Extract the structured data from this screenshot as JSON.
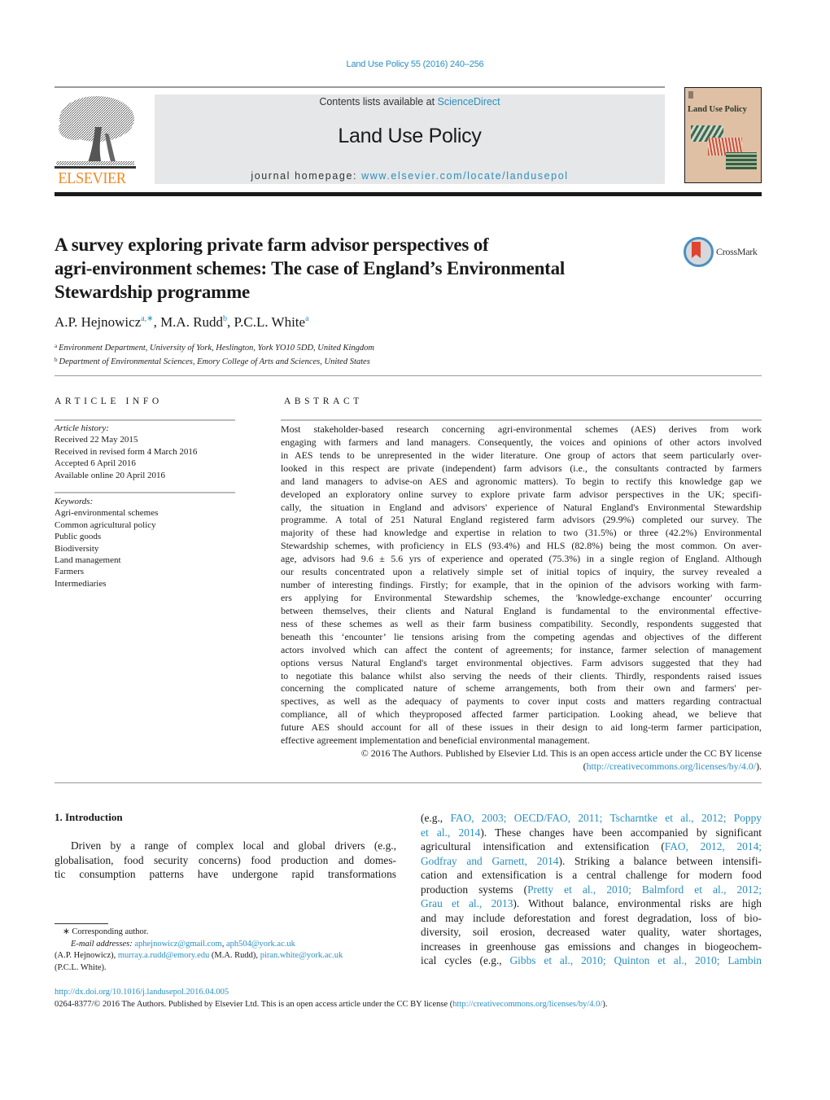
{
  "journal_ref": "Land Use Policy 55 (2016) 240–256",
  "header": {
    "publisher_logo_text": "ELSEVIER",
    "contents_prefix": "Contents lists available at ",
    "contents_link": "ScienceDirect",
    "journal_title": "Land Use Policy",
    "homepage_prefix": "journal homepage: ",
    "homepage_link": "www.elsevier.com/locate/landusepol",
    "cover_title": "Land Use Policy"
  },
  "article": {
    "title_lines": [
      "A survey exploring private farm advisor perspectives of",
      "agri-environment schemes: The case of England’s Environmental",
      "Stewardship programme"
    ],
    "crossmark_label": "CrossMark",
    "authors": [
      {
        "name": "A.P. Hejnowicz",
        "sup": "a,∗",
        "sep": ", "
      },
      {
        "name": "M.A. Rudd",
        "sup": "b",
        "sep": ", "
      },
      {
        "name": "P.C.L. White",
        "sup": "a",
        "sep": ""
      }
    ],
    "affiliations": [
      {
        "mark": "a",
        "text": "Environment Department, University of York, Heslington, York YO10 5DD, United Kingdom"
      },
      {
        "mark": "b",
        "text": "Department of Environmental Sciences, Emory College of Arts and Sciences, United States"
      }
    ]
  },
  "article_info": {
    "heading": "ARTICLE INFO",
    "history_label": "Article history:",
    "history": [
      "Received 22 May 2015",
      "Received in revised form 4 March 2016",
      "Accepted 6 April 2016",
      "Available online 20 April 2016"
    ],
    "keywords_label": "Keywords:",
    "keywords": [
      "Agri-environmental schemes",
      "Common agricultural policy",
      "Public goods",
      "Biodiversity",
      "Land management",
      "Farmers",
      "Intermediaries"
    ]
  },
  "abstract": {
    "heading": "ABSTRACT",
    "lines": [
      "Most stakeholder-based research concerning agri-environmental schemes (AES) derives from work",
      "engaging with farmers and land managers. Consequently, the voices and opinions of other actors involved",
      "in AES tends to be unrepresented in the wider literature. One group of actors that seem particularly over-",
      "looked in this respect are private (independent) farm advisors (i.e., the consultants contracted by farmers",
      "and land managers to advise-on AES and agronomic matters). To begin to rectify this knowledge gap we",
      "developed an exploratory online survey to explore private farm advisor perspectives in the UK; specifi-",
      "cally, the situation in England and advisors' experience of Natural England's Environmental Stewardship",
      "programme. A total of 251 Natural England registered farm advisors (29.9%) completed our survey. The",
      "majority of these had knowledge and expertise in relation to two (31.5%) or three (42.2%) Environmental",
      "Stewardship schemes, with proficiency in ELS (93.4%) and HLS (82.8%) being the most common. On aver-",
      "age, advisors had 9.6 ± 5.6 yrs of experience and operated (75.3%) in a single region of England. Although",
      "our results concentrated upon a relatively simple set of initial topics of inquiry, the survey revealed a",
      "number of interesting findings. Firstly; for example, that in the opinion of the advisors working with farm-",
      "ers applying for Environmental Stewardship schemes, the 'knowledge-exchange encounter' occurring",
      "between themselves, their clients and Natural England is fundamental to the environmental effective-",
      "ness of these schemes as well as their farm business compatibility. Secondly, respondents suggested that",
      "beneath this ‘encounter’ lie tensions arising from the competing agendas and objectives of the different",
      "actors involved which can affect the content of agreements; for instance, farmer selection of management",
      "options versus Natural England's target environmental objectives. Farm advisors suggested that they had",
      "to negotiate this balance whilst also serving the needs of their clients. Thirdly, respondents raised issues",
      "concerning the complicated nature of scheme arrangements, both from their own and farmers' per-",
      "spectives, as well as the adequacy of payments to cover input costs and matters regarding contractual",
      "compliance, all of which theyproposed affected farmer participation. Looking ahead, we believe that",
      "future AES should account for all of these issues in their design to aid long-term farmer participation,",
      "effective agreement implementation and beneficial environmental management."
    ],
    "copyright": "© 2016 The Authors. Published by Elsevier Ltd. This is an open access article under the CC BY license",
    "license_open": "(",
    "license_link": "http://creativecommons.org/licenses/by/4.0/",
    "license_close": ")."
  },
  "introduction": {
    "heading": "1.  Introduction",
    "left_lines": [
      "Driven by a range of complex local and global drivers (e.g.,",
      "globalisation, food security concerns) food production and domes-",
      "tic consumption patterns have undergone rapid transformations"
    ],
    "right_lines": [
      [
        {
          "t": "(e.g., "
        },
        {
          "t": "FAO, 2003; OECD/FAO, 2011; Tscharntke et al., 2012; Poppy",
          "link": true
        }
      ],
      [
        {
          "t": "et al., 2014",
          "link": true
        },
        {
          "t": "). These changes have been accompanied by significant"
        }
      ],
      [
        {
          "t": "agricultural intensification and extensification ("
        },
        {
          "t": "FAO, 2012, 2014;",
          "link": true
        }
      ],
      [
        {
          "t": "Godfray and Garnett, 2014",
          "link": true
        },
        {
          "t": "). Striking a balance between intensifi-"
        }
      ],
      [
        {
          "t": "cation and extensification is a central challenge for modern food"
        }
      ],
      [
        {
          "t": "production systems ("
        },
        {
          "t": "Pretty et al., 2010; Balmford et al., 2012;",
          "link": true
        }
      ],
      [
        {
          "t": "Grau et al., 2013",
          "link": true
        },
        {
          "t": "). Without balance, environmental risks are high"
        }
      ],
      [
        {
          "t": "and may include deforestation and forest degradation, loss of bio-"
        }
      ],
      [
        {
          "t": "diversity, soil erosion, decreased water quality, water shortages,"
        }
      ],
      [
        {
          "t": "increases in greenhouse gas emissions and changes in biogeochem-"
        }
      ],
      [
        {
          "t": "ical cycles (e.g., "
        },
        {
          "t": "Gibbs et al., 2010; Quinton et al., 2010; Lambin",
          "link": true
        }
      ]
    ]
  },
  "footnotes": {
    "corresponding": "∗  Corresponding author.",
    "email_label": "E-mail addresses: ",
    "email1": "aphejnowicz@gmail.com",
    "email2": "aph504@york.ac.uk",
    "who1": "(A.P. Hejnowicz), ",
    "email3": "murray.a.rudd@emory.edu",
    "who2": " (M.A. Rudd), ",
    "email4": "piran.white@york.ac.uk",
    "who3": "(P.C.L. White)."
  },
  "bottom": {
    "doi": "http://dx.doi.org/10.1016/j.landusepol.2016.04.005",
    "license_text": "0264-8377/© 2016 The Authors. Published by Elsevier Ltd. This is an open access article under the CC BY license (",
    "license_link": "http://creativecommons.org/licenses/by/4.0/",
    "license_close": ")."
  }
}
